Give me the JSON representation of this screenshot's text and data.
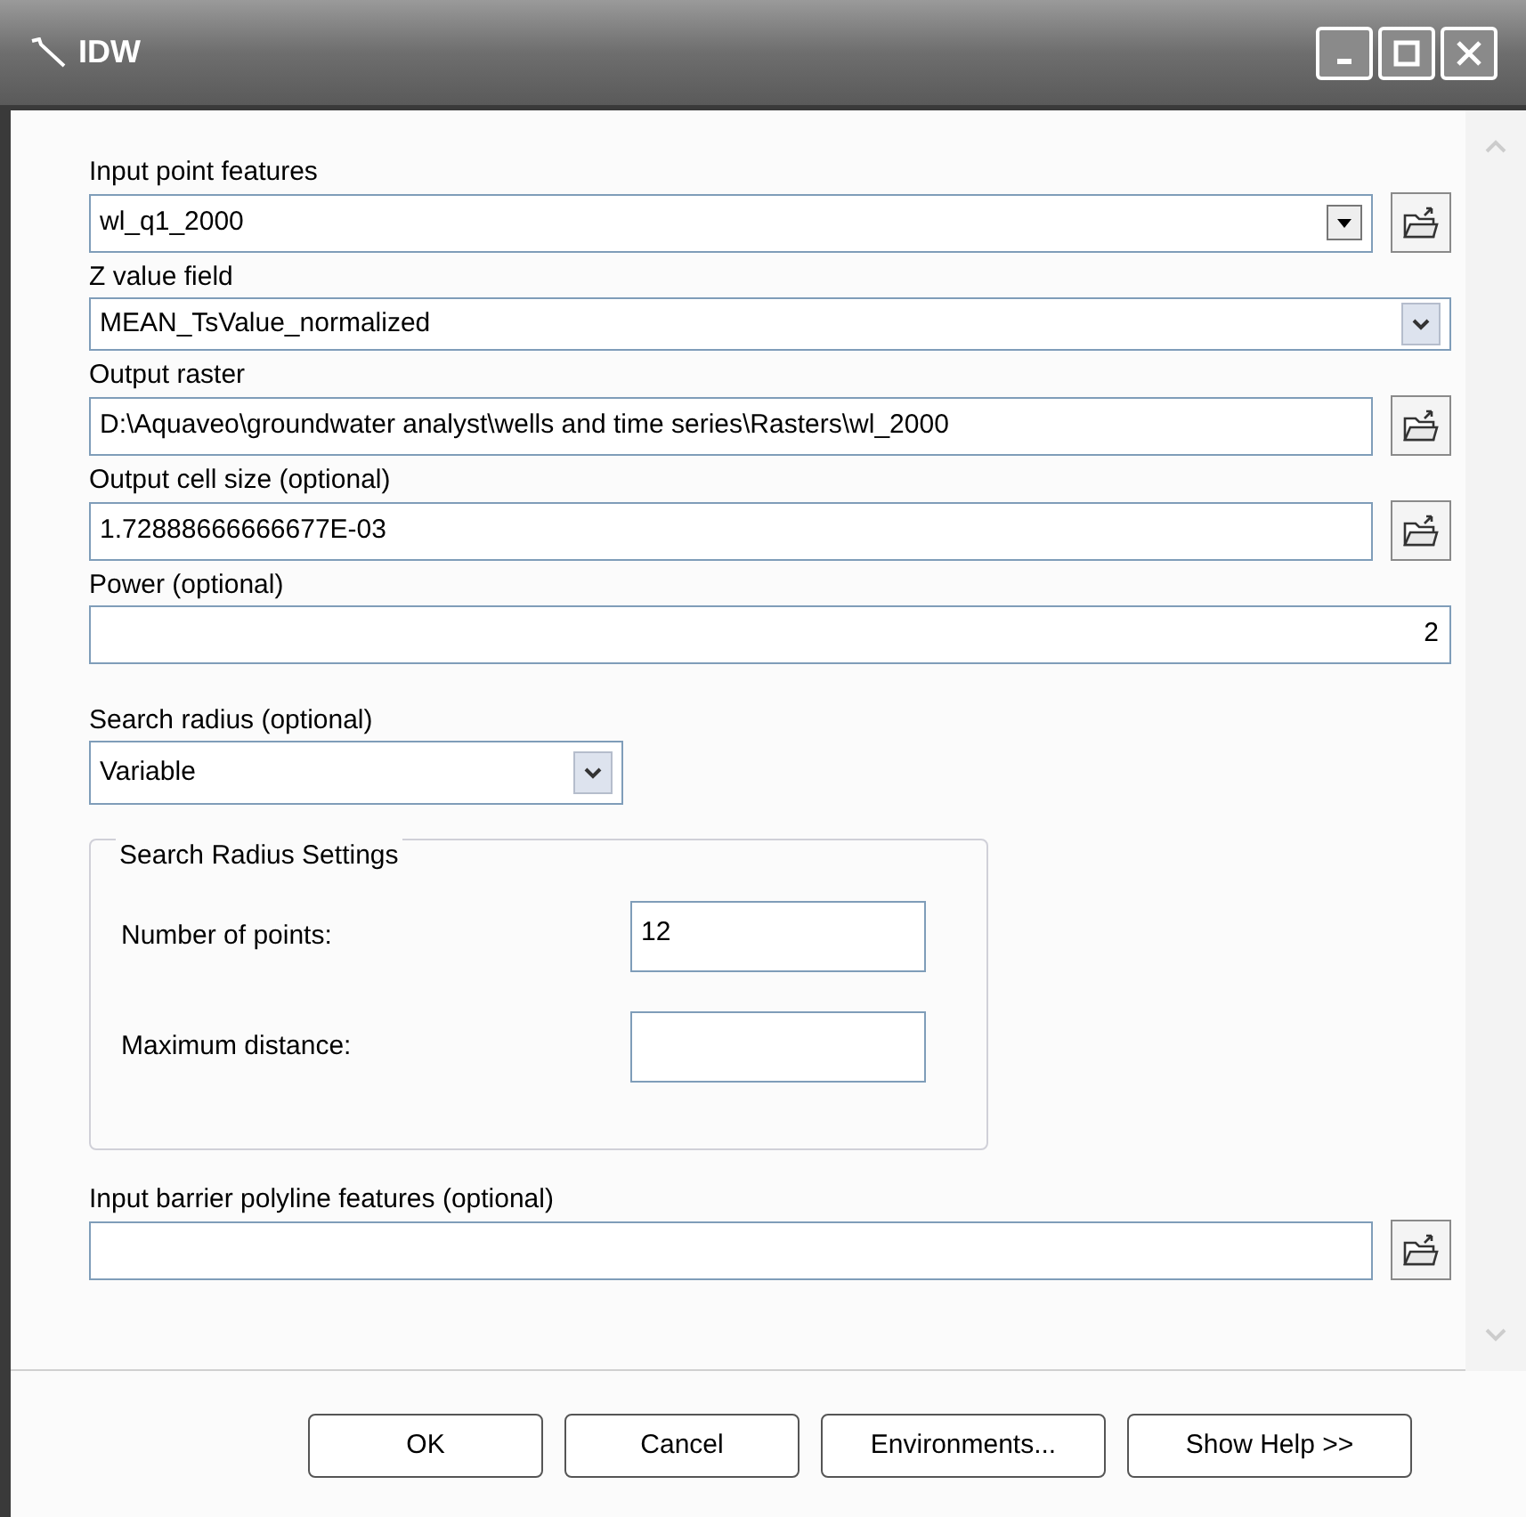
{
  "window": {
    "title": "IDW"
  },
  "parameters": [
    {
      "kind": "combo_browse",
      "label": "Input point features",
      "value": "wl_q1_2000"
    },
    {
      "kind": "select",
      "label": "Z value field",
      "value": "MEAN_TsValue_normalized"
    },
    {
      "kind": "text_browse",
      "label": "Output raster",
      "value": "D:\\Aquaveo\\groundwater analyst\\wells and time series\\Rasters\\wl_2000"
    },
    {
      "kind": "text_browse",
      "label": "Output cell size (optional)",
      "value": "1.72888666666677E-03"
    },
    {
      "kind": "number",
      "label": "Power (optional)",
      "value": "2"
    },
    {
      "kind": "select_short",
      "label": "Search radius (optional)",
      "value": "Variable"
    },
    {
      "kind": "group",
      "title": "Search Radius Settings",
      "rows": [
        {
          "label": "Number of points:",
          "value": "12"
        },
        {
          "label": "Maximum distance:"
        }
      ]
    },
    {
      "kind": "text_browse",
      "label": "Input barrier polyline features (optional)"
    }
  ],
  "buttons": [
    "OK",
    "Cancel",
    "Environments...",
    "Show Help >>"
  ]
}
